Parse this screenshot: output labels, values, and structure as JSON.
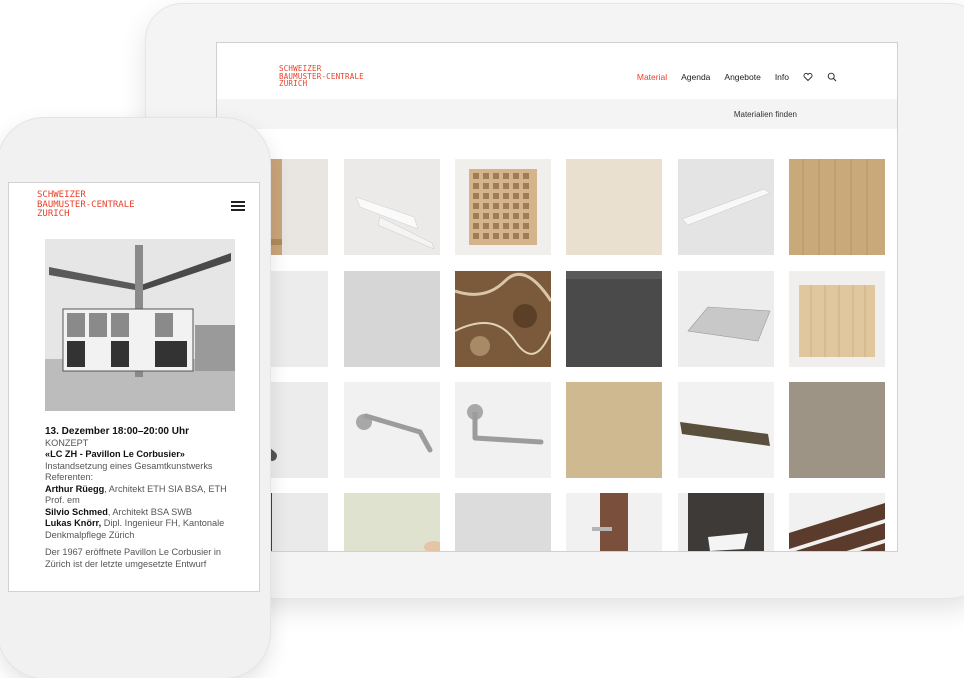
{
  "logo_lines": [
    "SCHWEIZER",
    "BAUMUSTER-CENTRALE",
    "ZURICH"
  ],
  "tablet": {
    "nav": {
      "material": "Material",
      "agenda": "Agenda",
      "angebote": "Angebote",
      "info": "Info"
    },
    "find_link": "Materialien finden",
    "accent_color": "#e8402a",
    "tiles": [
      [
        "wood-board",
        "white-profile",
        "perforated-block",
        "beige-texture",
        "white-panel",
        "wood-veneer"
      ],
      [
        "steel-ball",
        "grey-panel",
        "brown-marble",
        "dark-grey-panel",
        "metal-plate",
        "bamboo-block"
      ],
      [
        "rebar",
        "door-handle-bent",
        "door-handle-straight",
        "sand-texture",
        "stone-slab",
        "granite-texture"
      ],
      [
        "dark-metal",
        "glass-panel",
        "grey-panel-light",
        "door-with-handle",
        "wash-basin",
        "dark-wood-decking"
      ]
    ]
  },
  "phone": {
    "event": {
      "date": "13. Dezember 18:00–20:00 Uhr",
      "type": "KONZEPT",
      "title": "«LC ZH - Pavillon Le Corbusier»",
      "subtitle": "Instandsetzung eines Gesamtkunstwerks",
      "referents_label": "Referenten:",
      "speakers": [
        {
          "name": "Arthur Rüegg",
          "role": ", Architekt ETH SIA BSA, ETH Prof. em"
        },
        {
          "name": "Silvio Schmed",
          "role": ", Architekt BSA SWB"
        },
        {
          "name": "Lukas Knörr,",
          "role": " Dipl. Ingenieur FH, Kantonale Denkmalpflege Zürich"
        }
      ],
      "description": "Der 1967 eröffnete Pavillon Le Corbusier in Zürich ist der letzte umgesetzte Entwurf"
    }
  }
}
